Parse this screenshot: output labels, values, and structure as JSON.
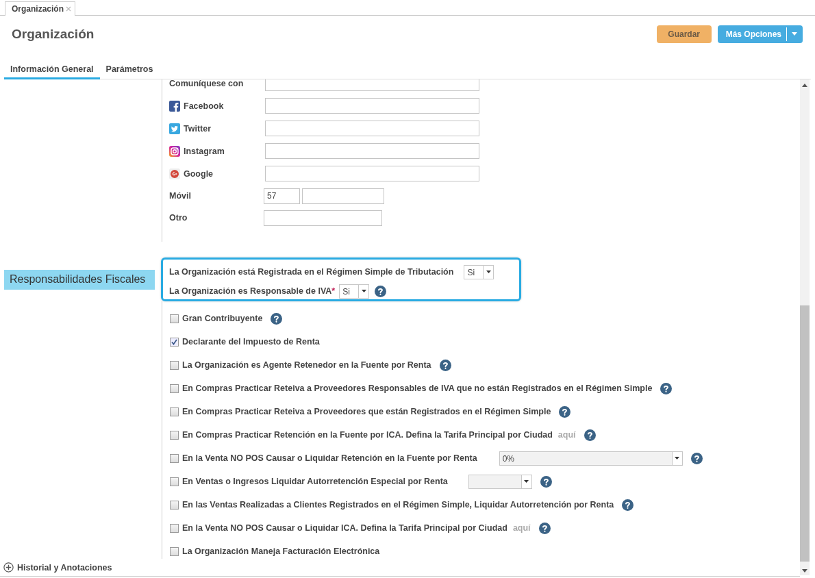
{
  "doc_tab": {
    "label": "Organización"
  },
  "page_title": "Organización",
  "buttons": [
    {
      "label": "Guardar",
      "kind": "save"
    },
    {
      "label": "Más Opciones",
      "kind": "split"
    }
  ],
  "tabs": [
    {
      "label": "Información General",
      "selected": true
    },
    {
      "label": "Parámetros",
      "selected": false
    }
  ],
  "contact_fields": [
    {
      "label": "Comuníquese con",
      "kind": "plain"
    },
    {
      "label": "Facebook",
      "kind": "facebook"
    },
    {
      "label": "Twitter",
      "kind": "twitter"
    },
    {
      "label": "Instagram",
      "kind": "instagram"
    },
    {
      "label": "Google",
      "kind": "google"
    },
    {
      "label": "Móvil",
      "kind": "phone",
      "prefix": "57"
    },
    {
      "label": "Otro",
      "kind": "short"
    }
  ],
  "section_label": "Responsabilidades Fiscales",
  "highlighted": [
    {
      "label": "La Organización está Registrada en el Régimen Simple de Tributación",
      "value": "Si",
      "help": false
    },
    {
      "label": "La Organización es Responsable de IVA",
      "required_mark": "*",
      "value": "Si",
      "help": true
    }
  ],
  "options": [
    {
      "label": "Gran Contribuyente",
      "checked": false,
      "help": true
    },
    {
      "label": "Declarante del Impuesto de Renta",
      "checked": true,
      "help": false
    },
    {
      "label": "La Organización es Agente Retenedor en la Fuente por Renta",
      "checked": false,
      "help": true
    },
    {
      "label": "En Compras Practicar Reteiva a Proveedores Responsables de IVA que no están Registrados en el Régimen Simple",
      "checked": false,
      "help": true
    },
    {
      "label": "En Compras Practicar Reteiva a Proveedores que están Registrados en el Régimen Simple",
      "checked": false,
      "help": true
    },
    {
      "label": "En Compras Practicar Retención en la Fuente por ICA. Defina la Tarifa Principal por Ciudad",
      "checked": false,
      "link": "aquí",
      "help": true
    },
    {
      "label": "En la Venta NO POS Causar o Liquidar Retención en la Fuente por Renta",
      "checked": false,
      "select": {
        "value": "0%",
        "kind": "wide"
      },
      "help": true
    },
    {
      "label": "En Ventas o Ingresos Liquidar Autorretención Especial por Renta",
      "checked": false,
      "select": {
        "kind": "narrow"
      },
      "help": true
    },
    {
      "label": "En las Ventas Realizadas a Clientes Registrados en el Régimen Simple, Liquidar Autorretención por Renta",
      "checked": false,
      "help": true
    },
    {
      "label": "En la Venta NO POS Causar o Liquidar ICA. Defina la Tarifa Principal por Ciudad",
      "checked": false,
      "link": "aquí",
      "help": true
    },
    {
      "label": "La Organización Maneja Facturación Electrónica",
      "checked": false,
      "help": false
    }
  ],
  "footer": {
    "label": "Historial y Anotaciones"
  }
}
